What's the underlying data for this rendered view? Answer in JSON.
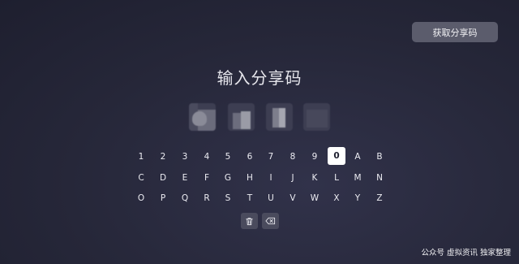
{
  "header": {
    "get_code_label": "获取分享码"
  },
  "main": {
    "title": "输入分享码"
  },
  "keyboard": {
    "rows": [
      [
        "1",
        "2",
        "3",
        "4",
        "5",
        "6",
        "7",
        "8",
        "9",
        "0",
        "A",
        "B"
      ],
      [
        "C",
        "D",
        "E",
        "F",
        "G",
        "H",
        "I",
        "J",
        "K",
        "L",
        "M",
        "N"
      ],
      [
        "O",
        "P",
        "Q",
        "R",
        "S",
        "T",
        "U",
        "V",
        "W",
        "X",
        "Y",
        "Z"
      ]
    ],
    "selected_key": "0",
    "actions": [
      "trash-icon",
      "backspace-icon"
    ]
  },
  "watermark": {
    "text": "公众号 虚拟资讯 独家整理"
  },
  "colors": {
    "background": "#262739",
    "button": "#5b5c6c",
    "selected_key": "#ffffff"
  }
}
